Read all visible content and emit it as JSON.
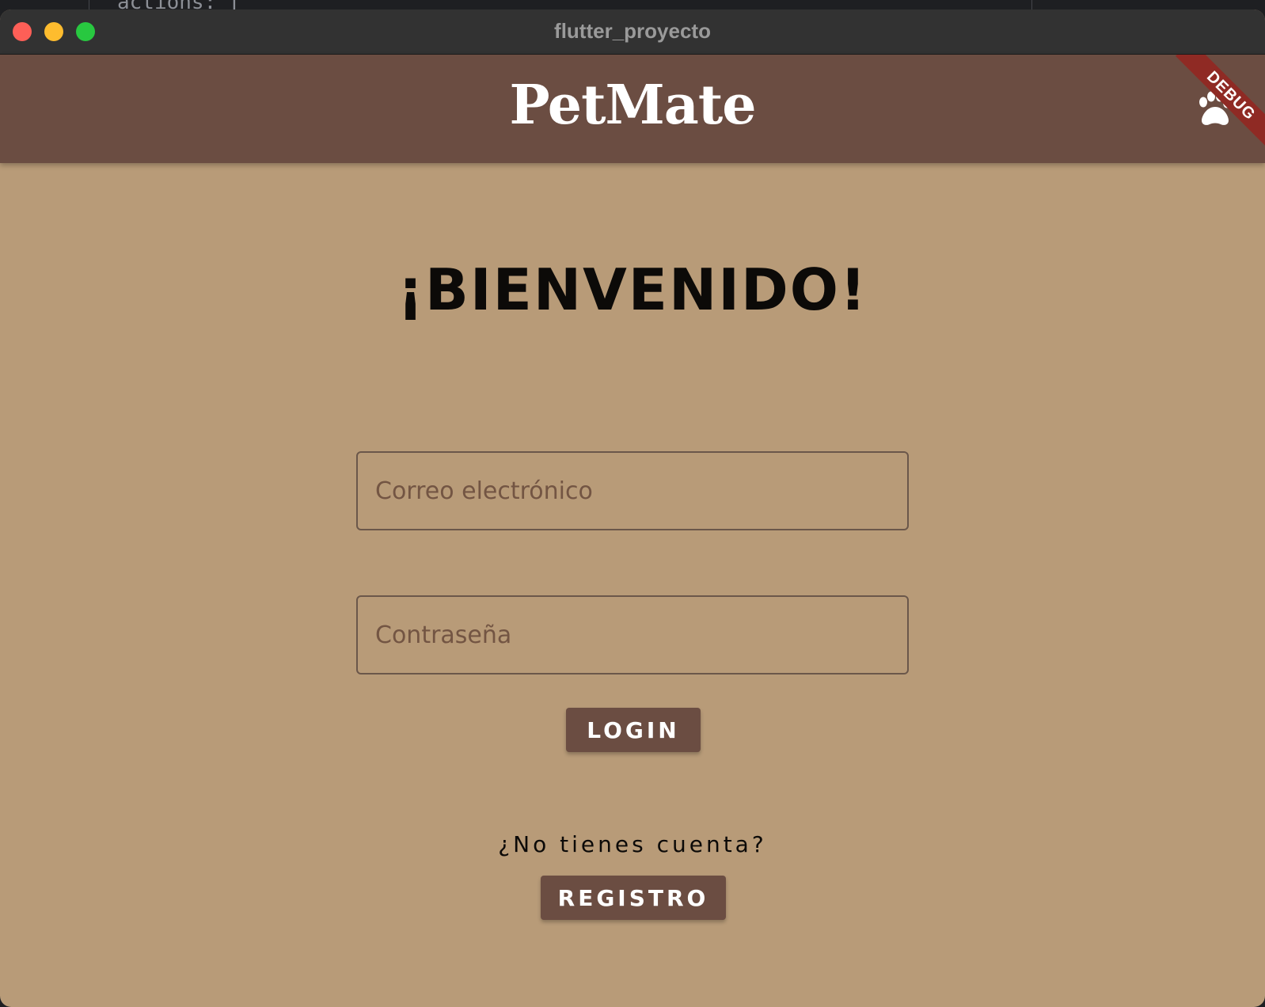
{
  "backdrop": {
    "code_snippet": "actions: ["
  },
  "window": {
    "title": "flutter_proyecto"
  },
  "appbar": {
    "title": "PetMate",
    "debug_banner": "DEBUG",
    "action_icon": "paw-icon"
  },
  "login": {
    "heading": "¡BIENVENIDO!",
    "email_placeholder": "Correo electrónico",
    "password_placeholder": "Contraseña",
    "login_label": "LOGIN",
    "no_account_text": "¿No tienes cuenta?",
    "register_label": "REGISTRO"
  },
  "colors": {
    "background": "#b89b78",
    "appbar": "#6b4d42",
    "button": "#6b4d42",
    "placeholder": "#735543",
    "debug_ribbon": "#8f2a24"
  }
}
